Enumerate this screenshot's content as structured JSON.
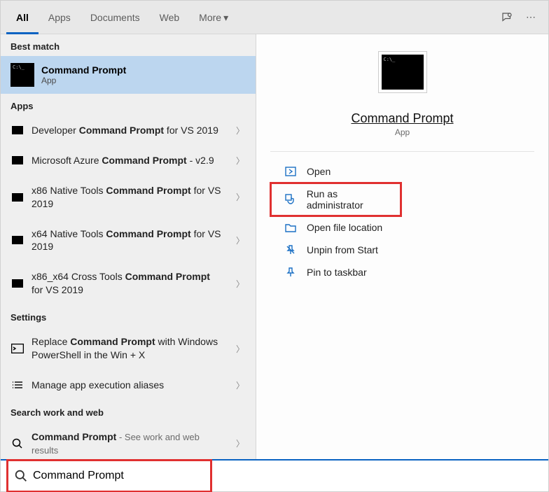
{
  "tabs": {
    "all": "All",
    "apps": "Apps",
    "documents": "Documents",
    "web": "Web",
    "more": "More"
  },
  "sections": {
    "best_match": "Best match",
    "apps": "Apps",
    "settings": "Settings",
    "work_web": "Search work and web"
  },
  "best_match": {
    "title": "Command Prompt",
    "subtitle": "App"
  },
  "apps_results": [
    {
      "pre": "Developer ",
      "bold": "Command Prompt",
      "post": " for VS 2019"
    },
    {
      "pre": "Microsoft Azure ",
      "bold": "Command Prompt",
      "post": " - v2.9"
    },
    {
      "pre": "x86 Native Tools ",
      "bold": "Command Prompt",
      "post": " for VS 2019"
    },
    {
      "pre": "x64 Native Tools ",
      "bold": "Command Prompt",
      "post": " for VS 2019"
    },
    {
      "pre": "x86_x64 Cross Tools ",
      "bold": "Command Prompt",
      "post": " for VS 2019"
    }
  ],
  "settings_results": [
    {
      "pre": "Replace ",
      "bold": "Command Prompt",
      "post": " with Windows PowerShell in the Win + X"
    },
    {
      "pre": "Manage app execution aliases",
      "bold": "",
      "post": ""
    }
  ],
  "web_result": {
    "bold": "Command Prompt",
    "hint": " - See work and web results"
  },
  "detail": {
    "title": "Command Prompt",
    "subtitle": "App",
    "actions": {
      "open": "Open",
      "run_admin": "Run as administrator",
      "open_location": "Open file location",
      "unpin_start": "Unpin from Start",
      "pin_taskbar": "Pin to taskbar"
    }
  },
  "search": {
    "value": "Command Prompt"
  }
}
